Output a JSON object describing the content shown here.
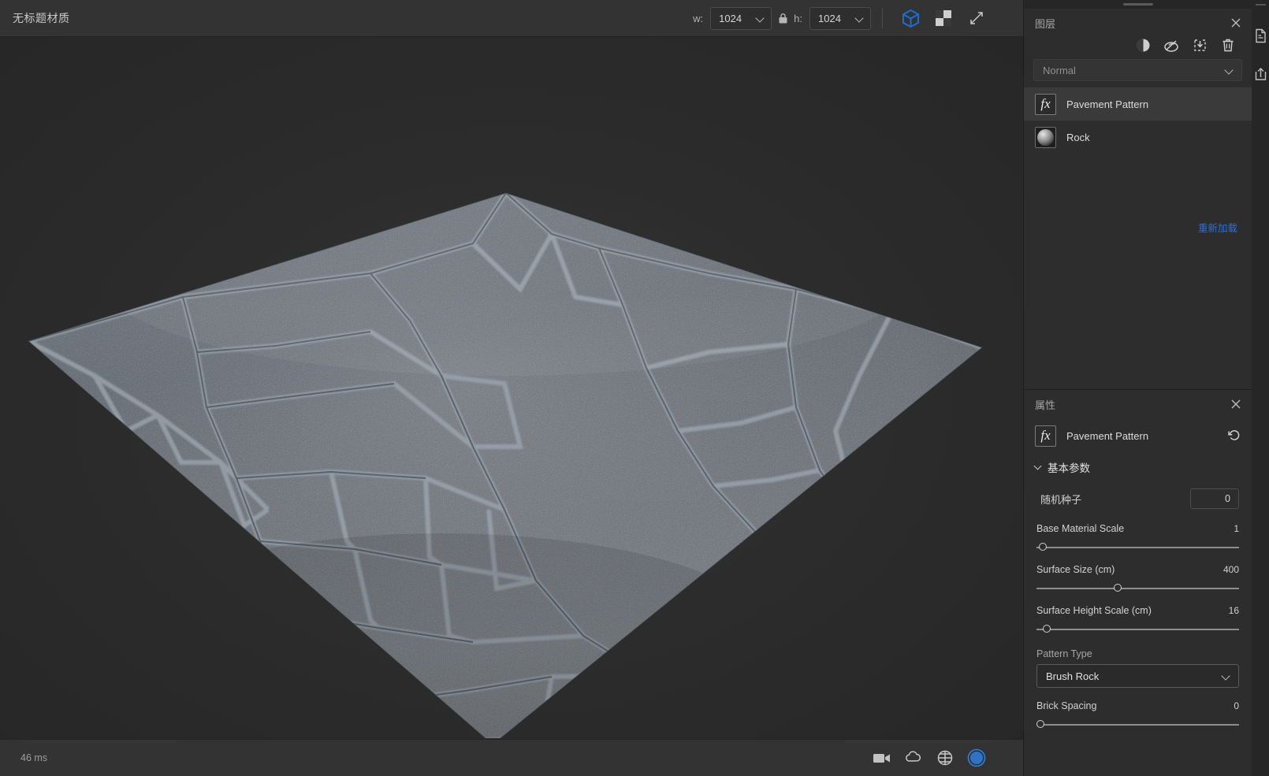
{
  "window": {
    "document_title": "无标题材质"
  },
  "toolbar": {
    "width_label": "w:",
    "width_value": "1024",
    "height_label": "h:",
    "height_value": "1024",
    "lock_icon": "lock-icon",
    "cube_icon": "3d-cube-icon",
    "checker_icon": "checker-2d-icon",
    "expand_icon": "expand-arrows-icon",
    "accent_color": "#1a6fd4"
  },
  "viewport": {
    "render_time": "46 ms",
    "tools": [
      {
        "name": "camera-icon",
        "label": "Camera"
      },
      {
        "name": "environment-icon",
        "label": "Environment"
      },
      {
        "name": "grid-globe-icon",
        "label": "Grid"
      },
      {
        "name": "lighting-icon",
        "label": "Lighting",
        "active": true
      }
    ],
    "active_color": "#2f7fe0"
  },
  "layers_panel": {
    "title": "图层",
    "close_icon": "close-icon",
    "tools": [
      {
        "name": "contrast-icon",
        "label": "Adjustment"
      },
      {
        "name": "mask-icon",
        "label": "Mask"
      },
      {
        "name": "import-icon",
        "label": "Import"
      },
      {
        "name": "trash-icon",
        "label": "Delete"
      }
    ],
    "blend_mode": "Normal",
    "items": [
      {
        "name": "Pavement Pattern",
        "thumb": "fx",
        "selected": true
      },
      {
        "name": "Rock",
        "thumb": "sphere",
        "selected": false
      }
    ],
    "reload_link": "重新加载",
    "link_color": "#2f6fd0"
  },
  "properties_panel": {
    "title": "属性",
    "close_icon": "close-icon",
    "node_name": "Pavement Pattern",
    "node_thumb": "fx",
    "revert_icon": "revert-icon",
    "section": {
      "title": "基本参数",
      "expanded": true
    },
    "params": [
      {
        "label": "随机种子",
        "type": "number",
        "value": "0"
      },
      {
        "label": "Base Material Scale",
        "type": "slider",
        "value": "1",
        "fill": 2
      },
      {
        "label": "Surface Size (cm)",
        "type": "slider",
        "value": "400",
        "fill": 40
      },
      {
        "label": "Surface Height Scale (cm)",
        "type": "slider",
        "value": "16",
        "fill": 4
      },
      {
        "label": "Pattern Type",
        "type": "dropdown",
        "value": "Brush Rock"
      },
      {
        "label": "Brick Spacing",
        "type": "slider",
        "value": "0",
        "fill": 1
      }
    ]
  }
}
